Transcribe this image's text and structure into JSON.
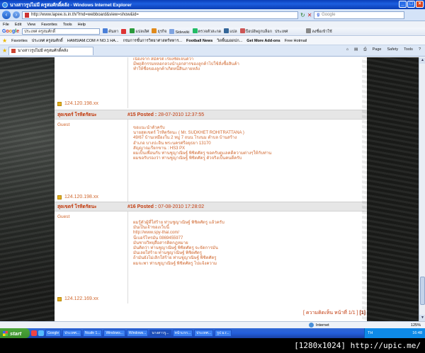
{
  "window": {
    "title": "นางสาวรูปไม่มี ครูสมศักดิ์คลัง - Windows Internet Explorer",
    "buttons": [
      "_",
      "□",
      "×"
    ]
  },
  "address": {
    "url": "http://www.lapee.is.in.th/?md=webboard&view=show&id=",
    "search_placeholder": "Google"
  },
  "menu": [
    "File",
    "Edit",
    "View",
    "Favorites",
    "Tools",
    "Help"
  ],
  "google_toolbar": {
    "logo": [
      "G",
      "o",
      "o",
      "g",
      "l",
      "e"
    ],
    "search_value": "ประเทศ ครูสมศักดิ์",
    "items": [
      "ค้นหา",
      "แปลเลิศ",
      "ธุรกิจ",
      "Sidewiki",
      "ตรวจตัวสะกด",
      "แปล",
      "ป๊อปอัพถูกบล็อก",
      "ประเทศ"
    ],
    "signin": "ลงชื่อเข้าใช้"
  },
  "links_bar": {
    "label": "Favorites",
    "items": [
      "ประเทศ ครูสมศักดิ์",
      "HAMSIAM.COM # NO.1 HA...",
      "กรมการขั้นการวิทยาศาสตร์ทหาร...",
      "Football News",
      "วิดพื้นมอดปก...",
      "Get More Add-ons",
      "Free Hotmail"
    ]
  },
  "tab": {
    "label": "นางสาวรูปไม่มี ครูสมศักดิ์คลัง",
    "commands": [
      "Page",
      "Safety",
      "Tools"
    ]
  },
  "posts": [
    {
      "author": "",
      "role": "",
      "number": "",
      "date": "",
      "ip": "124.120.198.xx",
      "lines": [
        "เนื่องจาก สมัครดี เรียงชัดเจนดีว่า",
        "มีพฤติกรรมหลอกลวงนำเอกสารของลูกค้าไปใช้สั่งซื้อสินค้า",
        "ทำให้ชื่อของลูกค้าเกิดหนี้สินภายหลัง"
      ]
    },
    {
      "author": "สุดเขตร์ โรหิตรัตนะ",
      "role": "Guest",
      "number": "#15 Posted :",
      "date": "28-07-2010 12:37:55",
      "ip": "124.120.198.xx",
      "lines": [
        "ขอแนะนำตัวครับ",
        "นายสุดเขตร์ โรหิตรัตนะ ( Mr. SUDKHET ROHITRATTANA )",
        "49/67 บ้านเหมืองใน 2 หมู่ 7 ถนน โรงนม ตำบล บ้านสร้าง",
        "อำเภอ บางปะอิน พระนครศรีอยุธยา 13170",
        "สัญญาณเรียกขาน : HS3 PX",
        "ผมเป็นเพื่อนกับ ท่านชูญาณิษฐ์ พิชิตศัตรู ขอครับดูแลคดีความต่างๆให้กับท่าน",
        "ผมขอรับรองว่า ท่านชูญาณิษฐ์ พิชิตศัตรู ตัวจริงเป็นคนดีครับ"
      ]
    },
    {
      "author": "สุดเขตร์ โรหิตรัตนะ",
      "role": "Guest",
      "number": "#16 Posted :",
      "date": "07-08-2010 17:28:02",
      "ip": "124.122.169.xx",
      "lines": [
        "ผมรู้ตัวผู้ที่ใส่ร้าย ท่านชูญาณิษฐ์ พิชิตศัตรู แล้วครับ",
        "มันเป็นเจ้าของเว็บนี้",
        "http://www.spy-thai.com/",
        "นี่เบอร์โทรมัน 0869455977",
        "มันชายวิทยุสื่อสารติดกฎหมาย",
        "มันคิดว่า ท่านชูญาณิษฐ์ พิชิตศัตรู จะจัดการมัน",
        "มันเลยใส่ร้าย ท่านชูญาณิษฐ์ พิชิตศัตรู",
        "ถ้ามันยังไม่เลิกใส่ร้าย ท่านชูญาณิษฐ์ พิชิตศัตรู",
        "ผมจะพา ท่านชูญาณิษฐ์ พิชิตศัตรู ไปแจ้งความ"
      ]
    }
  ],
  "pager": {
    "text": "[ ความคิดเห็น หน้าที่ 1/1 ]",
    "page": "[1]"
  },
  "status": {
    "zone": "Internet",
    "zoom": "125%"
  },
  "taskbar": {
    "start": "start",
    "buttons": [
      "Google",
      "ประเทศ...",
      "Ncafe 1...",
      "Windows...",
      "Windows...",
      "นางสาวรู...",
      "หน้าแรก...",
      "ประเทศ...",
      "รูป ม.r..."
    ],
    "tray_lang": "TH",
    "time": "16:48"
  },
  "watermark": "[1280x1024] http://upic.me/",
  "colors": {
    "accent": "#c23b0e",
    "text_orange": "#d0672e",
    "header_bg": "#e6e6e6"
  }
}
